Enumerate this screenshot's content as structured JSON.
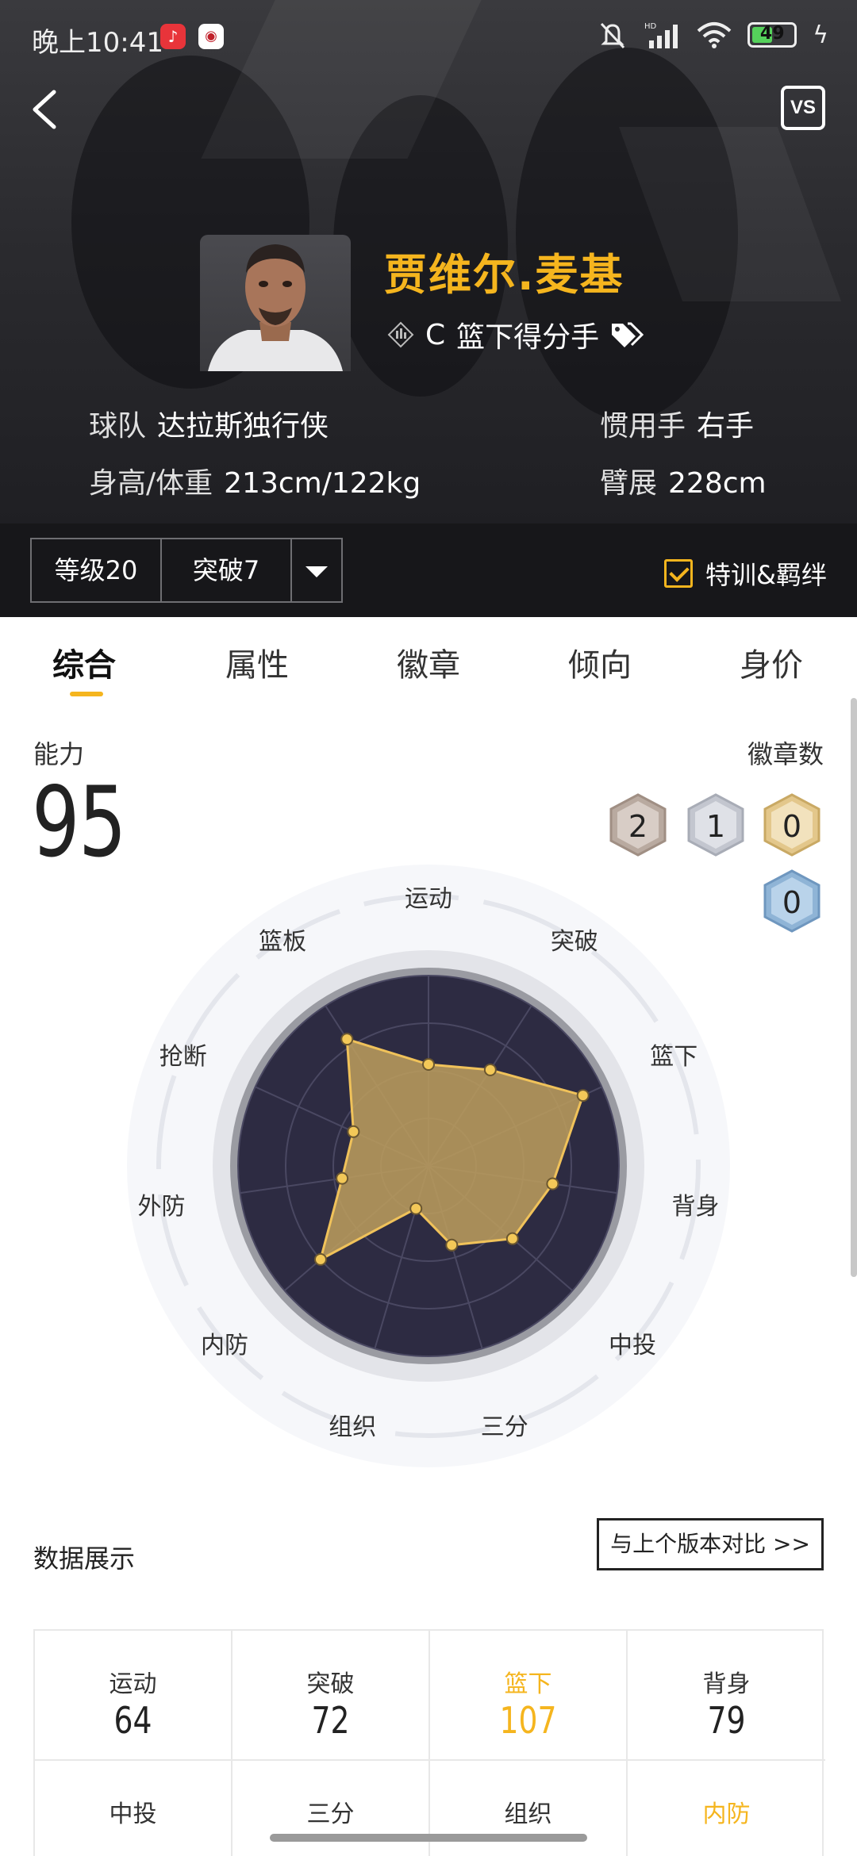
{
  "status": {
    "time": "晚上10:41",
    "app1_icon": "netease-music-icon",
    "app2_icon": "app-logo-icon",
    "battery_level": "49"
  },
  "header": {
    "back_icon": "back-arrow-icon",
    "vs_label": "VS"
  },
  "player": {
    "name": "贾维尔.麦基",
    "position": "C",
    "role": "篮下得分手",
    "team_label": "球队",
    "team": "达拉斯独行侠",
    "hand_label": "惯用手",
    "hand": "右手",
    "body_label": "身高/体重",
    "body": "213cm/122kg",
    "wingspan_label": "臂展",
    "wingspan": "228cm"
  },
  "filters": {
    "level": "等级20",
    "breakthrough": "突破7",
    "training_label": "特训&羁绊",
    "training_checked": true
  },
  "tabs": [
    {
      "label": "综合",
      "active": true
    },
    {
      "label": "属性",
      "active": false
    },
    {
      "label": "徽章",
      "active": false
    },
    {
      "label": "倾向",
      "active": false
    },
    {
      "label": "身价",
      "active": false
    }
  ],
  "ability": {
    "label": "能力",
    "value": "95"
  },
  "badges": {
    "label": "徽章数",
    "items": [
      {
        "count": "2",
        "tier": "bronze",
        "color": "#b9aaa0"
      },
      {
        "count": "1",
        "tier": "silver",
        "color": "#c3c6cf"
      },
      {
        "count": "0",
        "tier": "gold",
        "color": "#e3c78b"
      },
      {
        "count": "0",
        "tier": "blue",
        "color": "#8fb4d6"
      }
    ]
  },
  "chart_data": {
    "type": "radar",
    "axes": [
      "运动",
      "突破",
      "篮下",
      "背身",
      "中投",
      "三分",
      "组织",
      "内防",
      "外防",
      "抢断",
      "篮板"
    ],
    "values": [
      64,
      72,
      107,
      79,
      70,
      52,
      28,
      90,
      55,
      52,
      95
    ],
    "max": 120,
    "fill_color": "#b99b5c",
    "line_color": "#f0c25a"
  },
  "data_section": {
    "label": "数据展示",
    "compare_button": "与上个版本对比 >>",
    "cells": [
      {
        "label": "运动",
        "value": "64",
        "highlight": false
      },
      {
        "label": "突破",
        "value": "72",
        "highlight": false
      },
      {
        "label": "篮下",
        "value": "107",
        "highlight": true
      },
      {
        "label": "背身",
        "value": "79",
        "highlight": false
      },
      {
        "label": "中投",
        "value": "",
        "highlight": false
      },
      {
        "label": "三分",
        "value": "",
        "highlight": false
      },
      {
        "label": "组织",
        "value": "",
        "highlight": false
      },
      {
        "label": "内防",
        "value": "",
        "highlight": true
      }
    ]
  }
}
